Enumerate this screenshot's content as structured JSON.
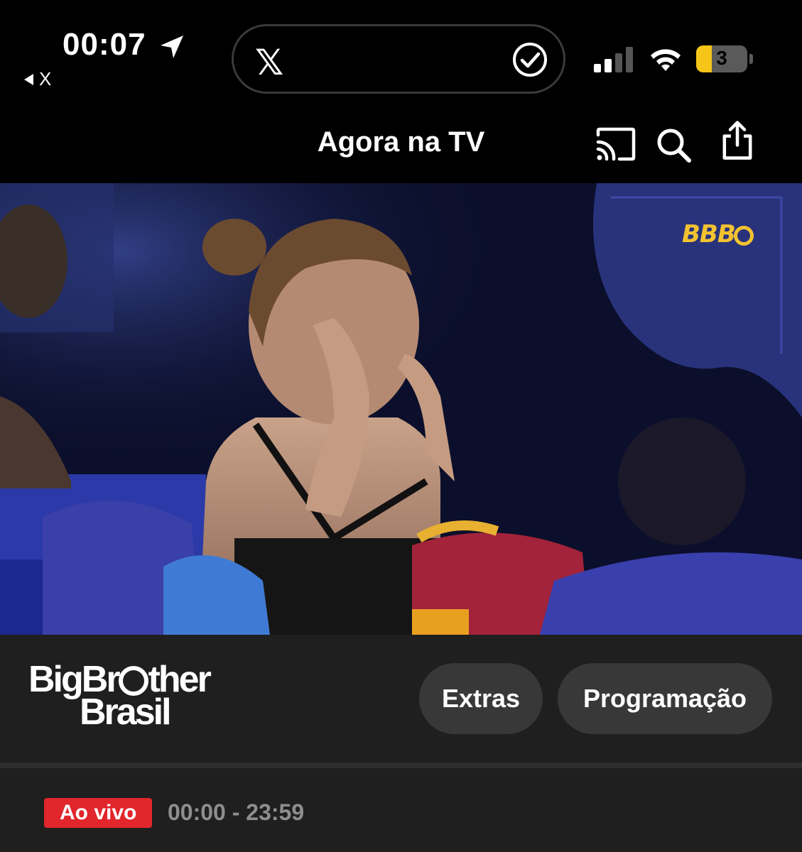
{
  "status_bar": {
    "time": "00:07",
    "back_app": "X",
    "island_app": "𝕏",
    "battery_level": "3",
    "icons": [
      "location-arrow-icon",
      "signal-icon",
      "wifi-icon",
      "battery-icon",
      "checkmark-icon"
    ]
  },
  "nav": {
    "title": "Agora na TV",
    "icons": [
      "cast-icon",
      "search-icon",
      "share-icon"
    ]
  },
  "video": {
    "watermark": "BBB"
  },
  "show": {
    "logo_line1": "BigBr",
    "logo_line1_tail": "ther",
    "logo_line2": "Brasil",
    "extras_label": "Extras",
    "schedule_label": "Programação"
  },
  "live": {
    "badge": "Ao vivo",
    "time_range": "00:00 - 23:59"
  },
  "colors": {
    "accent_live": "#e1262c",
    "watermark": "#f2c230",
    "battery": "#f5c518"
  }
}
